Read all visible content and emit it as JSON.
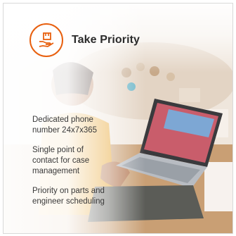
{
  "header": {
    "title": "Take Priority",
    "icon": "hand-with-box-icon",
    "accent_color": "#e8600f"
  },
  "features": [
    {
      "text": "Dedicated phone number 24x7x365"
    },
    {
      "text": "Single point of contact for case management"
    },
    {
      "text": "Priority on parts and engineer scheduling"
    }
  ]
}
